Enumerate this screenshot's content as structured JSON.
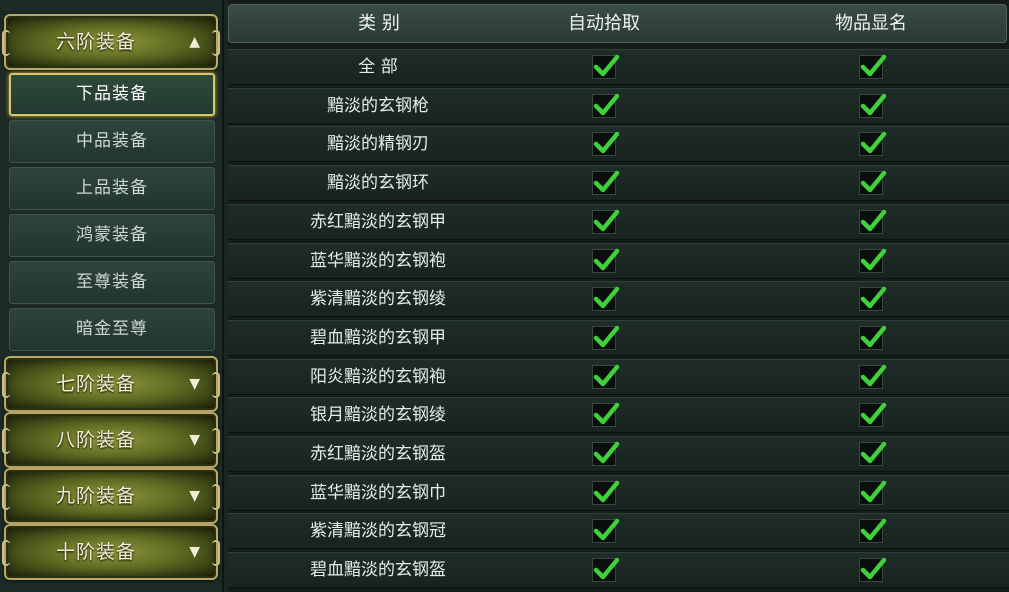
{
  "sidebar": {
    "top_category": {
      "label": "六阶装备",
      "arrow": "▲"
    },
    "sub_items": [
      "下品装备",
      "中品装备",
      "上品装备",
      "鸿蒙装备",
      "至尊装备",
      "暗金至尊"
    ],
    "active_sub": "下品装备",
    "categories": [
      {
        "label": "七阶装备",
        "arrow": "▼"
      },
      {
        "label": "八阶装备",
        "arrow": "▼"
      },
      {
        "label": "九阶装备",
        "arrow": "▼"
      },
      {
        "label": "十阶装备",
        "arrow": "▼"
      }
    ]
  },
  "table": {
    "headers": {
      "category": "类  别",
      "auto_pickup": "自动拾取",
      "show_name": "物品显名"
    },
    "rows": [
      {
        "name": "全  部",
        "auto_pickup": true,
        "show_name": true
      },
      {
        "name": "黯淡的玄钢枪",
        "auto_pickup": true,
        "show_name": true
      },
      {
        "name": "黯淡的精钢刃",
        "auto_pickup": true,
        "show_name": true
      },
      {
        "name": "黯淡的玄钢环",
        "auto_pickup": true,
        "show_name": true
      },
      {
        "name": "赤红黯淡的玄钢甲",
        "auto_pickup": true,
        "show_name": true
      },
      {
        "name": "蓝华黯淡的玄钢袍",
        "auto_pickup": true,
        "show_name": true
      },
      {
        "name": "紫清黯淡的玄钢绫",
        "auto_pickup": true,
        "show_name": true
      },
      {
        "name": "碧血黯淡的玄钢甲",
        "auto_pickup": true,
        "show_name": true
      },
      {
        "name": "阳炎黯淡的玄钢袍",
        "auto_pickup": true,
        "show_name": true
      },
      {
        "name": "银月黯淡的玄钢绫",
        "auto_pickup": true,
        "show_name": true
      },
      {
        "name": "赤红黯淡的玄钢盔",
        "auto_pickup": true,
        "show_name": true
      },
      {
        "name": "蓝华黯淡的玄钢巾",
        "auto_pickup": true,
        "show_name": true
      },
      {
        "name": "紫清黯淡的玄钢冠",
        "auto_pickup": true,
        "show_name": true
      },
      {
        "name": "碧血黯淡的玄钢盔",
        "auto_pickup": true,
        "show_name": true
      }
    ]
  },
  "colors": {
    "check": "#3fd13a",
    "active_border": "#d9c766"
  },
  "icons": {
    "checked": "checkmark-icon"
  }
}
